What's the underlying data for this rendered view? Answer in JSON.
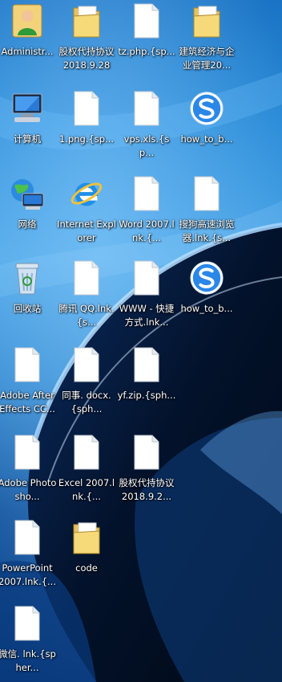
{
  "desktop": {
    "icons": [
      {
        "label": "Administr...",
        "icon": "user-icon"
      },
      {
        "label": "股权代持协议2018.9.28",
        "icon": "folder-icon"
      },
      {
        "label": "tz.php.{sp...",
        "icon": "document-icon"
      },
      {
        "label": "建筑经济与企业管理20...",
        "icon": "folder-icon"
      },
      {
        "label": "计算机",
        "icon": "computer-icon"
      },
      {
        "label": "1.png.{sp...",
        "icon": "document-icon"
      },
      {
        "label": "vps.xls.{sp...",
        "icon": "document-icon"
      },
      {
        "label": "how_to_b...",
        "icon": "sogou-icon"
      },
      {
        "label": "网络",
        "icon": "network-icon"
      },
      {
        "label": "Internet Explorer",
        "icon": "internet-explorer-icon"
      },
      {
        "label": "Word 2007.lnk.{...",
        "icon": "document-icon"
      },
      {
        "label": "搜狗高速浏览器.lnk.{s...",
        "icon": "document-icon"
      },
      {
        "label": "回收站",
        "icon": "recycle-bin-icon"
      },
      {
        "label": "腾讯 QQ.lnk.{s...",
        "icon": "document-icon"
      },
      {
        "label": "WWW - 快捷方式.lnk...",
        "icon": "document-icon"
      },
      {
        "label": "how_to_b...",
        "icon": "sogou-icon"
      },
      {
        "label": "Adobe After Effects CC...",
        "icon": "document-icon"
      },
      {
        "label": "同事. docx.{sph...",
        "icon": "document-icon"
      },
      {
        "label": "yf.zip.{sph...",
        "icon": "document-icon"
      },
      {
        "label": "Adobe Photosho...",
        "icon": "document-icon"
      },
      {
        "label": "Excel 2007.lnk.{...",
        "icon": "document-icon"
      },
      {
        "label": "股权代持协议2018.9.2...",
        "icon": "document-icon"
      },
      {
        "label": "PowerPoint 2007.lnk.{...",
        "icon": "document-icon"
      },
      {
        "label": "code",
        "icon": "folder-icon"
      },
      {
        "label": "微信. lnk.{spher...",
        "icon": "document-icon"
      }
    ]
  }
}
